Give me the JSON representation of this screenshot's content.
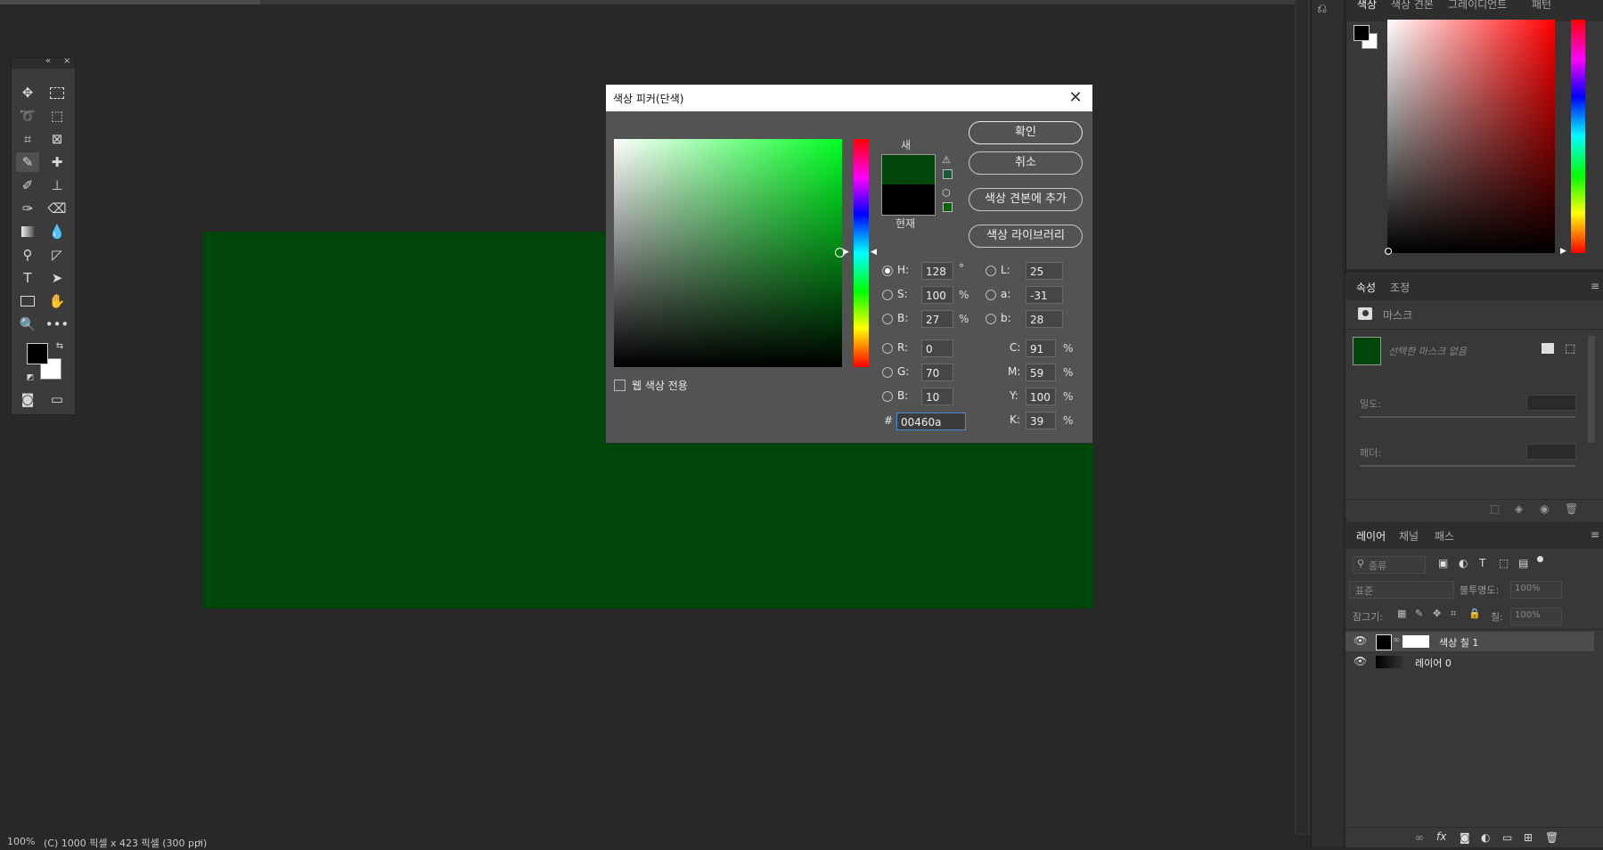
{
  "document": {
    "fill_color": "#00460a",
    "status": {
      "zoom": "100%",
      "info": "(C) 1000 픽셀 x 423 픽셀 (300 ppi)",
      "arrow": "›"
    }
  },
  "toolbox": {
    "collapse_label": "«",
    "close_label": "×"
  },
  "color_panel": {
    "tabs": [
      "색상",
      "색상 견본",
      "그레이디언트",
      "패턴"
    ],
    "menu_icon": "≡"
  },
  "properties_panel": {
    "tabs": [
      "속성",
      "조정"
    ],
    "menu_icon": "≡",
    "section_label": "마스크",
    "mask_status": "선택한 마스크 없음",
    "density_label": "밀도:",
    "feather_label": "페더:"
  },
  "layers_panel": {
    "tabs": [
      "레이어",
      "채널",
      "패스"
    ],
    "menu_icon": "≡",
    "filter_placeholder": "종류",
    "blend_mode": "표준",
    "opacity_label": "불투명도:",
    "opacity_value": "100%",
    "lock_label": "잠그기:",
    "fill_label": "칠:",
    "fill_value": "100%",
    "layers": [
      {
        "name": "색상 칠 1",
        "visible": true,
        "selected": true
      },
      {
        "name": "레이어 0",
        "visible": true,
        "selected": false
      }
    ]
  },
  "color_picker_dialog": {
    "title": "색상 피커(단색)",
    "close_icon": "close-icon",
    "new_label": "새",
    "current_label": "현재",
    "new_color": "#00460a",
    "current_color": "#000000",
    "buttons": {
      "ok": "확인",
      "cancel": "취소",
      "add_to_swatches": "색상 견본에 추가",
      "color_libraries": "색상 라이브러리"
    },
    "web_colors_only": "웹 색상 전용",
    "hsb": {
      "h_label": "H:",
      "h": "128",
      "h_unit": "°",
      "s_label": "S:",
      "s": "100",
      "s_unit": "%",
      "b_label": "B:",
      "b": "27",
      "b_unit": "%"
    },
    "rgb": {
      "r_label": "R:",
      "r": "0",
      "g_label": "G:",
      "g": "70",
      "b_label": "B:",
      "b": "10"
    },
    "lab": {
      "l_label": "L:",
      "l": "25",
      "a_label": "a:",
      "a": "-31",
      "b_label": "b:",
      "b": "28"
    },
    "cmyk": {
      "c_label": "C:",
      "c": "91",
      "m_label": "M:",
      "m": "59",
      "y_label": "Y:",
      "y": "100",
      "k_label": "K:",
      "k": "39",
      "unit": "%"
    },
    "hex_label": "#",
    "hex": "00460a"
  }
}
